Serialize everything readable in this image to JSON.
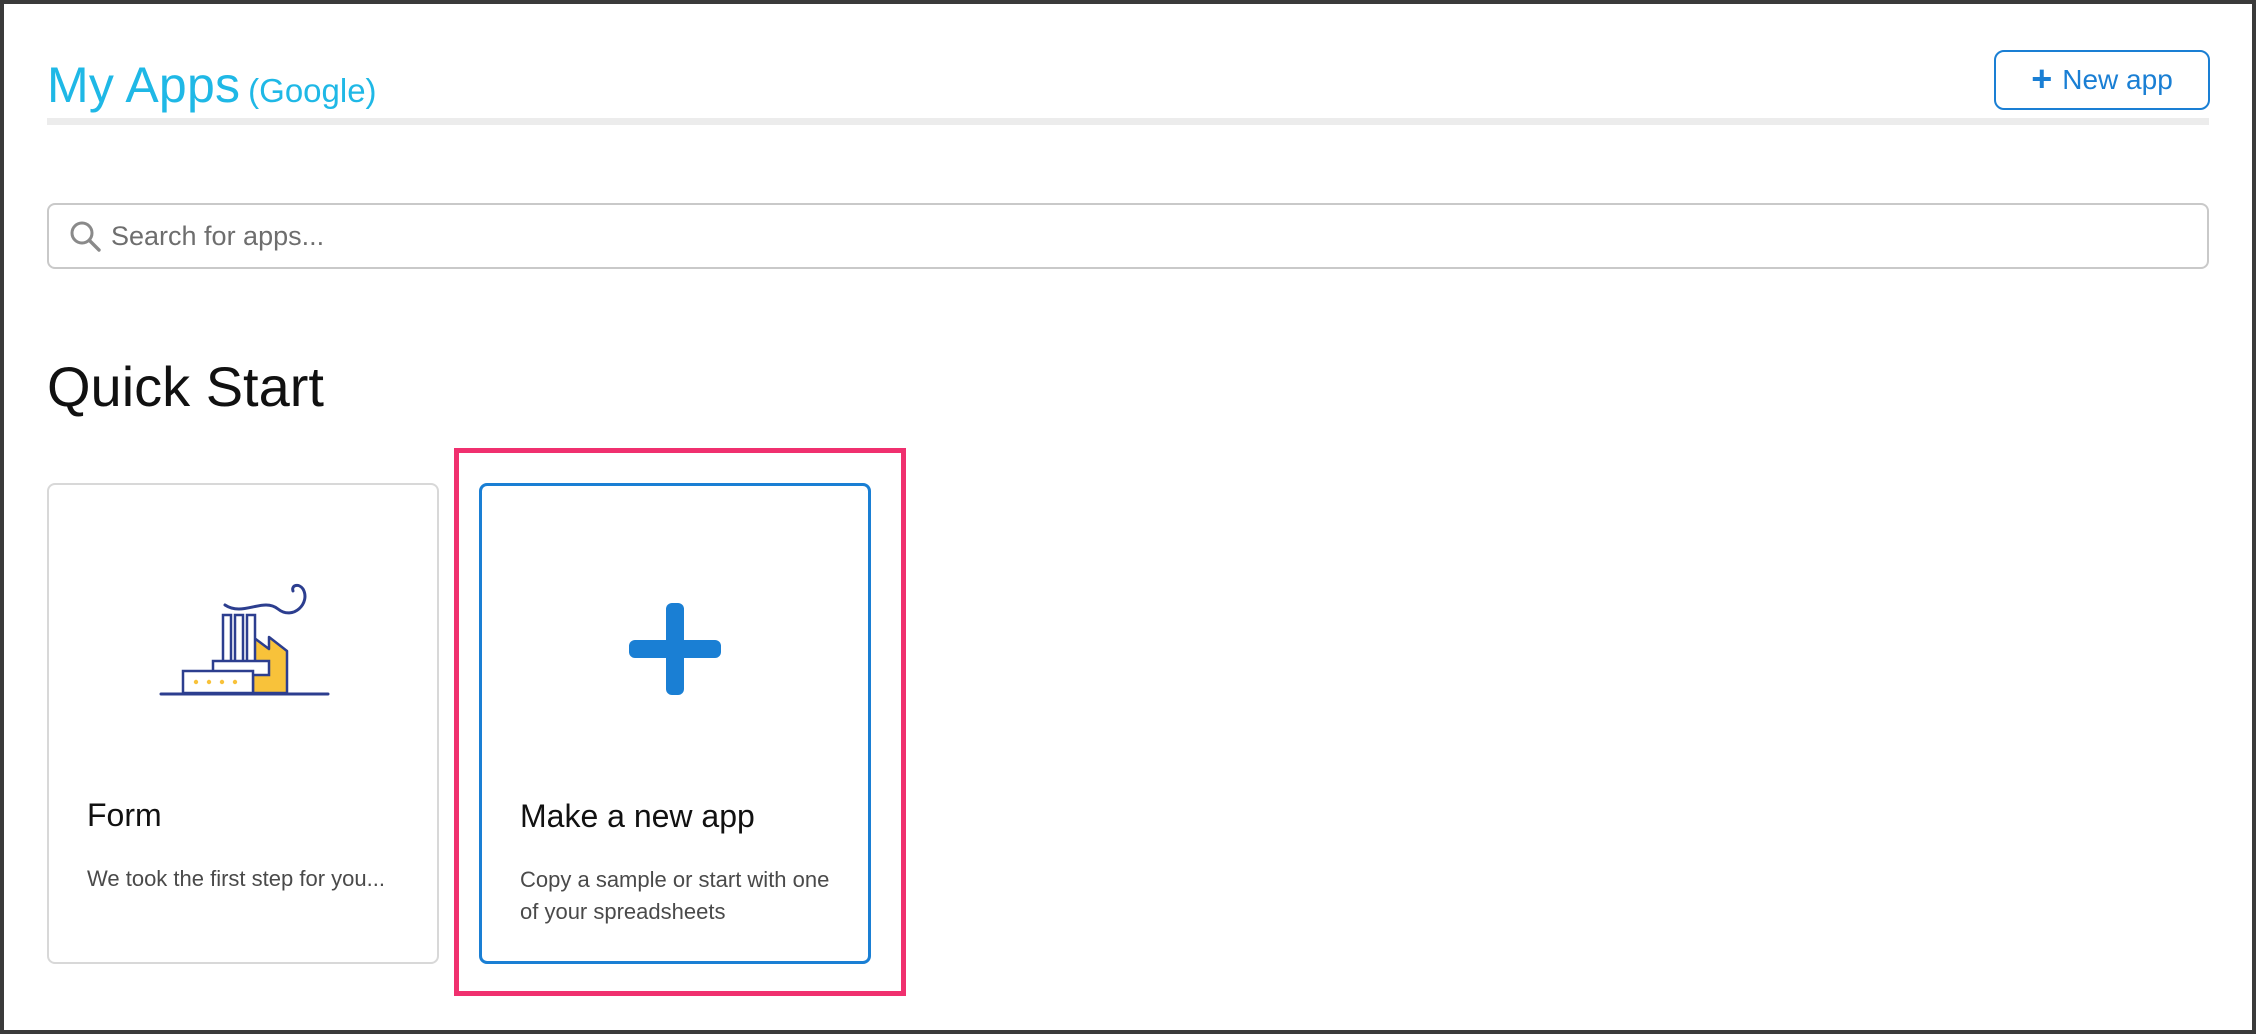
{
  "header": {
    "title": "My Apps",
    "subtitle": "(Google)",
    "new_app_label": "New app"
  },
  "search": {
    "placeholder": "Search for apps...",
    "value": ""
  },
  "quick_start": {
    "heading": "Quick Start",
    "cards": [
      {
        "title": "Form",
        "description": "We took the first step for you...",
        "icon": "factory-icon"
      },
      {
        "title": "Make a new app",
        "description": "Copy a sample or start with one of your spreadsheets",
        "icon": "plus-icon"
      }
    ]
  },
  "colors": {
    "accent": "#1a7fd4",
    "title": "#1fb8e6",
    "highlight": "#f0306f",
    "factory_yellow": "#f8c23a",
    "factory_navy": "#2c3e8f"
  }
}
